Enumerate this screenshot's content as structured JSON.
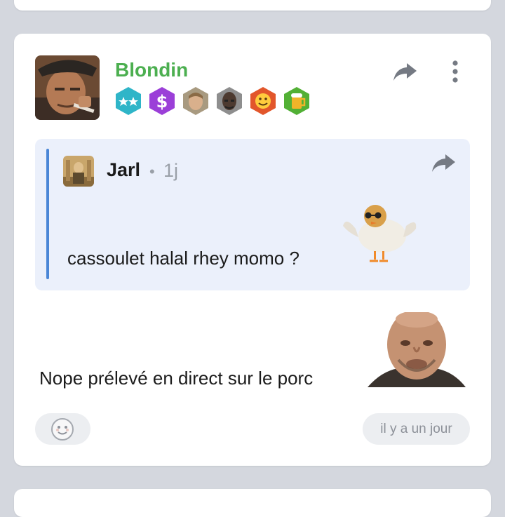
{
  "post": {
    "author": "Blondin",
    "author_color": "#4caf50",
    "badges": [
      "two-stars-badge",
      "dollar-badge",
      "portrait-badge",
      "bald-man-badge",
      "smiley-badge",
      "beer-badge"
    ],
    "quote": {
      "author": "Jarl",
      "separator": "•",
      "time": "1j",
      "text": "cassoulet halal rhey momo ?"
    },
    "reply_text": "Nope prélevé en direct sur le porc",
    "timestamp": "il y a un jour"
  },
  "colors": {
    "background": "#d4d7de",
    "card": "#ffffff",
    "quote_bg": "#ebf0fb",
    "quote_bar": "#4a86d6",
    "muted": "#9aa0a8"
  }
}
